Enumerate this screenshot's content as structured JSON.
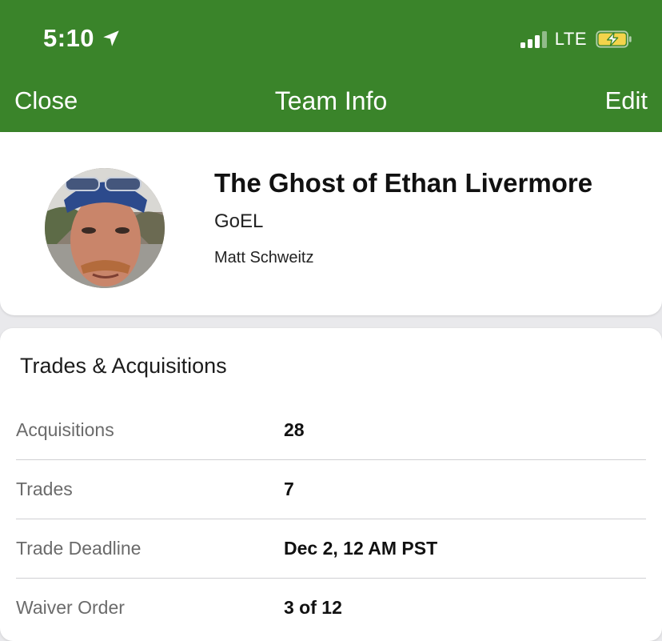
{
  "status_bar": {
    "time": "5:10",
    "network": "LTE"
  },
  "nav": {
    "close_label": "Close",
    "title": "Team Info",
    "edit_label": "Edit"
  },
  "profile": {
    "team_name": "The Ghost of Ethan Livermore",
    "abbreviation": "GoEL",
    "owner": "Matt Schweitz"
  },
  "trades_section": {
    "title": "Trades & Acquisitions",
    "rows": [
      {
        "label": "Acquisitions",
        "value": "28"
      },
      {
        "label": "Trades",
        "value": "7"
      },
      {
        "label": "Trade Deadline",
        "value": "Dec 2, 12 AM PST"
      },
      {
        "label": "Waiver Order",
        "value": "3 of 12"
      }
    ]
  },
  "colors": {
    "header_green": "#3a842a",
    "battery_fill": "#f3d44b"
  }
}
